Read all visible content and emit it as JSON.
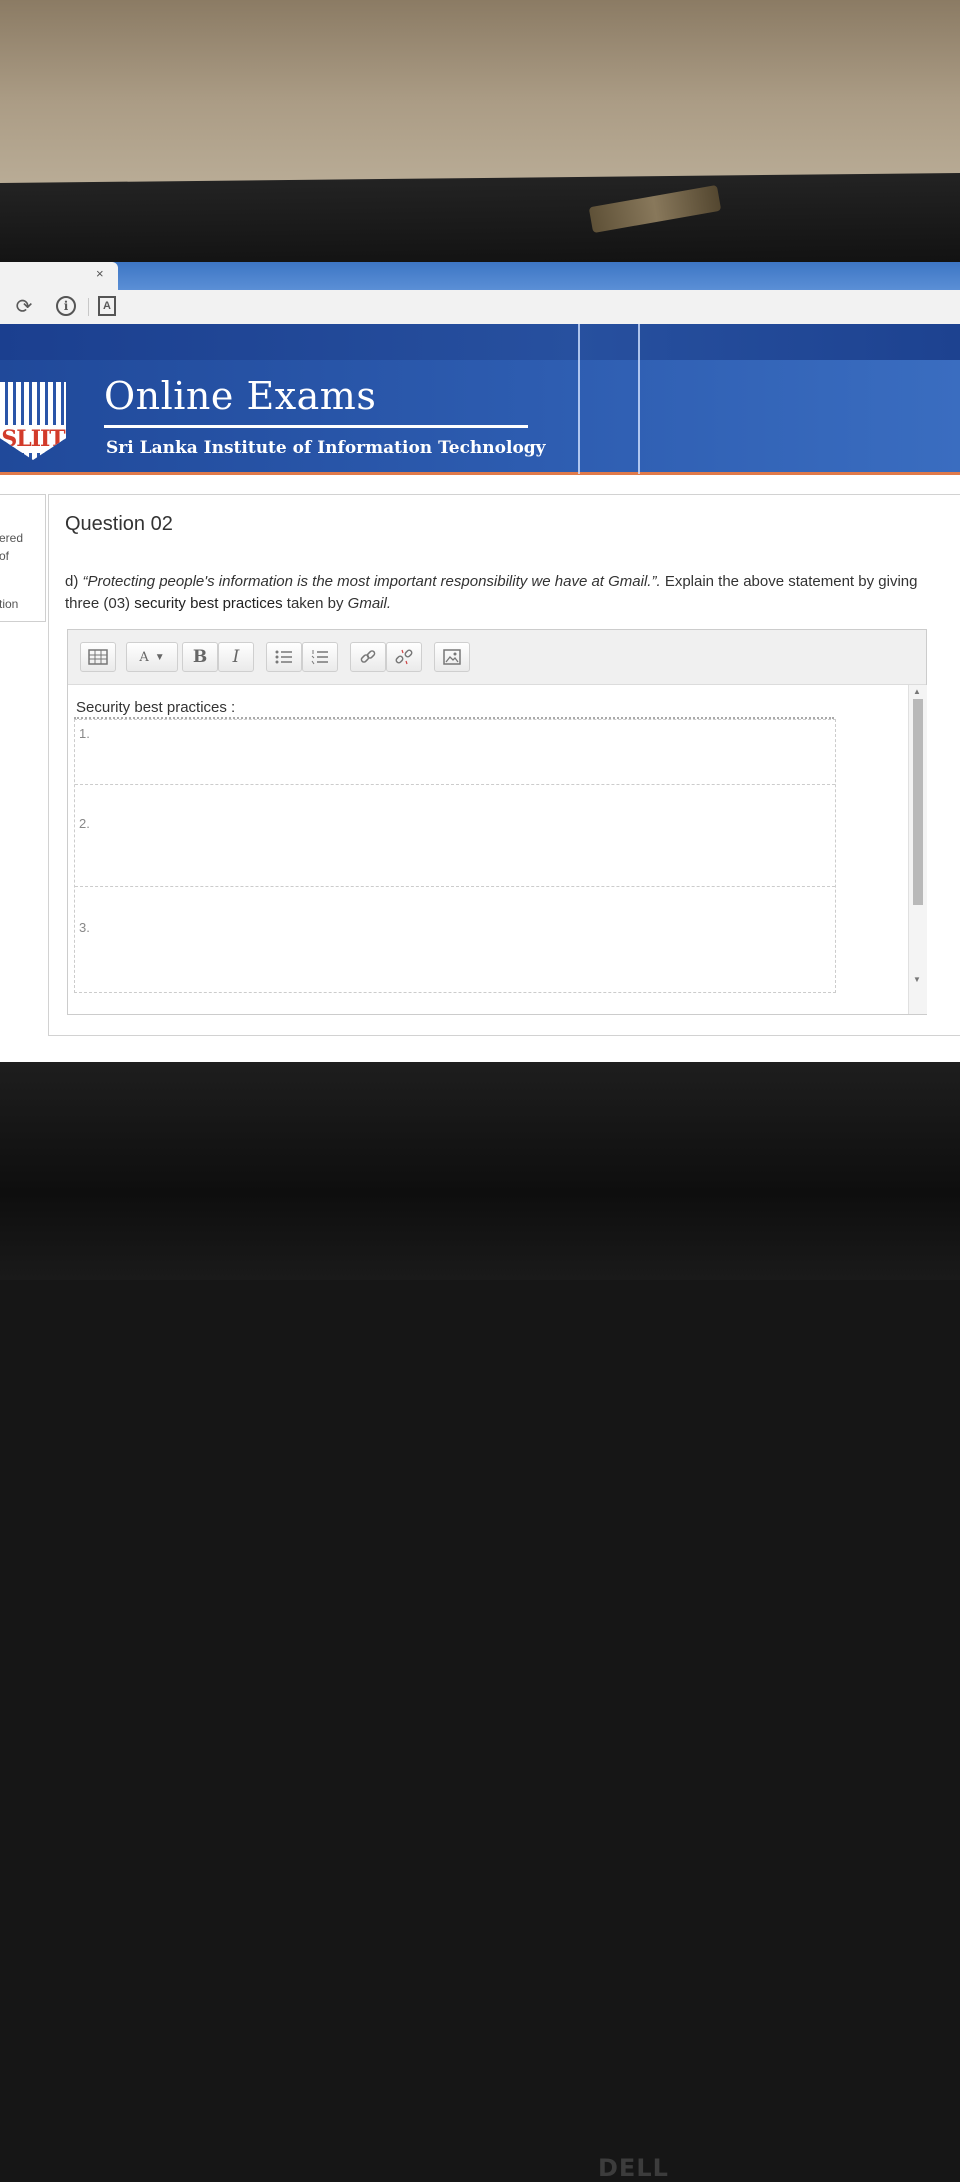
{
  "browser": {
    "tab_close": "×",
    "icons": [
      "reload-icon",
      "info-icon",
      "pdf-icon"
    ]
  },
  "banner": {
    "logo_text": "SLIIT",
    "title": "Online Exams",
    "subtitle": "Sri Lanka Institute of Information Technology"
  },
  "left_panel": {
    "line1": "ered",
    "line2": "of",
    "line3": "tion"
  },
  "question": {
    "title": "Question 02",
    "label": "d)",
    "quote": "“Protecting people's information is the most important responsibility we have at Gmail.”.",
    "prompt_a": "Explain the above statement by giving three (03)",
    "prompt_bold": "security best practices",
    "prompt_b": "taken by",
    "prompt_italic": "Gmail."
  },
  "editor": {
    "toolbar": [
      "table-icon",
      "font-size-dropdown",
      "bold",
      "italic",
      "bullet-list-icon",
      "numbered-list-icon",
      "link-icon",
      "unlink-icon",
      "image-icon"
    ],
    "bold_label": "B",
    "italic_label": "I",
    "font_size_label": "A",
    "heading": "Security best practices :",
    "items": [
      "1.",
      "2.",
      "3."
    ]
  },
  "device": {
    "brand": "DELL"
  }
}
